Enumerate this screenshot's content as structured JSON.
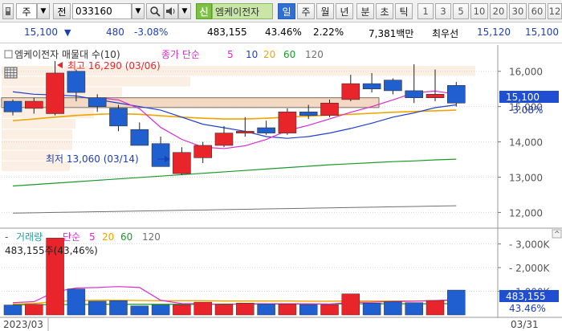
{
  "toolbar": {
    "market": "주",
    "market_dd": "▼",
    "mode": "전",
    "code": "033160",
    "code_dd": "▼",
    "name_badge": "신",
    "stock_name": "엠케이전자",
    "tabs": [
      "일",
      "주",
      "월",
      "년",
      "분",
      "초",
      "틱"
    ],
    "active_tab": "일",
    "periods": [
      "1",
      "3",
      "5",
      "10",
      "20",
      "30",
      "60",
      "12"
    ]
  },
  "info": {
    "price": "15,100",
    "price_arrow": "▼",
    "change": "480",
    "change_pct": "-3.08%",
    "volume": "483,155",
    "vol_ratio": "43.46%",
    "turnover": "2.22%",
    "amount": "7,381백만",
    "best_ask_label": "최우선",
    "best_ask": "15,120",
    "best_bid": "15,100"
  },
  "price_panel": {
    "legend_name": "엠케이전자 매물대 수(10)",
    "legend_ma": "종가 단순",
    "ma_periods": [
      "5",
      "10",
      "20",
      "60",
      "120"
    ],
    "max_label": "최고 16,290 (03/06)",
    "min_label": "최저 13,060 (03/14)",
    "y_ticks": [
      "16,000",
      "15,000",
      "14,000",
      "13,000",
      "12,000"
    ],
    "last_price": "15,100",
    "last_change": "-3.08%"
  },
  "volume_panel": {
    "legend_name": "거래량",
    "legend_ma": "단순",
    "ma_periods": [
      "5",
      "20",
      "60",
      "120"
    ],
    "value_label": "483,155주(43,46%)",
    "y_ticks": [
      "3,000K",
      "2,000K",
      "1,000K"
    ],
    "last_volume": "483,155",
    "last_pct": "43.46%"
  },
  "x_axis": {
    "start": "2023/03",
    "end": "03/31"
  },
  "colors": {
    "up": "#e8252b",
    "down": "#1f5fcf",
    "ma5": "#d72bd2",
    "ma10": "#1f3fcf",
    "ma20": "#f0a400",
    "ma60": "#1a9a2a",
    "ma120": "#707070"
  },
  "chart_data": {
    "type": "candlestick",
    "dates": [
      "03/02",
      "03/03",
      "03/06",
      "03/07",
      "03/08",
      "03/09",
      "03/10",
      "03/13",
      "03/14",
      "03/15",
      "03/16",
      "03/17",
      "03/20",
      "03/21",
      "03/22",
      "03/23",
      "03/24",
      "03/27",
      "03/28",
      "03/29",
      "03/30",
      "03/31"
    ],
    "open": [
      15150,
      14950,
      14800,
      16000,
      15250,
      14950,
      14350,
      13950,
      13100,
      13550,
      13900,
      14250,
      14400,
      14250,
      14850,
      14750,
      15200,
      15650,
      15750,
      15450,
      15250,
      15600
    ],
    "high": [
      15200,
      15250,
      16290,
      16050,
      15350,
      15050,
      14550,
      14150,
      13850,
      14000,
      14450,
      14700,
      14600,
      14950,
      15050,
      15200,
      15900,
      15950,
      15800,
      16200,
      16050,
      15700
    ],
    "low": [
      14750,
      14800,
      14750,
      15150,
      14850,
      14300,
      14100,
      13450,
      13060,
      13400,
      13850,
      14150,
      14200,
      14200,
      14650,
      14700,
      15150,
      15400,
      15350,
      15100,
      15150,
      15000
    ],
    "close": [
      14850,
      15150,
      15950,
      15400,
      15000,
      14450,
      13900,
      13300,
      13700,
      13900,
      14250,
      14300,
      14250,
      14850,
      14750,
      15100,
      15650,
      15500,
      15450,
      15250,
      15350,
      15100
    ],
    "volume": [
      420,
      450,
      3250,
      1100,
      580,
      600,
      380,
      420,
      430,
      540,
      450,
      500,
      460,
      460,
      430,
      430,
      890,
      500,
      560,
      520,
      610,
      1050
    ],
    "volume_last": 483,
    "volume_unit": "K",
    "ma5": [
      null,
      null,
      null,
      null,
      15250,
      15190,
      14940,
      14410,
      14070,
      13850,
      13810,
      13890,
      14070,
      14320,
      14470,
      14650,
      14840,
      15000,
      15190,
      15390,
      15440,
      15350
    ],
    "ma10": [
      15420,
      15350,
      15330,
      15300,
      15200,
      15100,
      15000,
      14900,
      14700,
      14500,
      14400,
      14300,
      14150,
      14100,
      14150,
      14250,
      14380,
      14530,
      14700,
      14820,
      14970,
      15050
    ],
    "ma20": [
      14600,
      14650,
      14700,
      14750,
      14780,
      14800,
      14780,
      14740,
      14700,
      14670,
      14650,
      14650,
      14670,
      14700,
      14730,
      14760,
      14780,
      14810,
      14840,
      14860,
      14880,
      14900
    ],
    "ma60": [
      12750,
      12790,
      12830,
      12870,
      12910,
      12950,
      12990,
      13030,
      13070,
      13110,
      13150,
      13190,
      13230,
      13270,
      13310,
      13350,
      13380,
      13410,
      13440,
      13460,
      13490,
      13510
    ],
    "ma120": [
      11980,
      11990,
      12000,
      12010,
      12020,
      12030,
      12040,
      12050,
      12060,
      12070,
      12080,
      12090,
      12100,
      12110,
      12120,
      12130,
      12140,
      12150,
      12160,
      12170,
      12180,
      12190
    ],
    "vol_ma5": [
      520,
      560,
      980,
      1140,
      1160,
      1200,
      1160,
      620,
      480,
      470,
      440,
      470,
      470,
      470,
      470,
      460,
      530,
      540,
      570,
      580,
      610,
      640
    ],
    "vol_ma20": [
      470,
      480,
      570,
      610,
      620,
      620,
      610,
      600,
      600,
      600,
      590,
      590,
      590,
      590,
      580,
      580,
      590,
      590,
      590,
      590,
      600,
      620
    ],
    "vol_ma60": [
      430,
      430,
      440,
      440,
      450,
      450,
      450,
      450,
      450,
      450,
      460,
      460,
      460,
      460,
      460,
      460,
      470,
      470,
      470,
      470,
      470,
      480
    ],
    "ylim_price": [
      11600,
      16700
    ],
    "ylim_volume": [
      0,
      3600
    ]
  }
}
